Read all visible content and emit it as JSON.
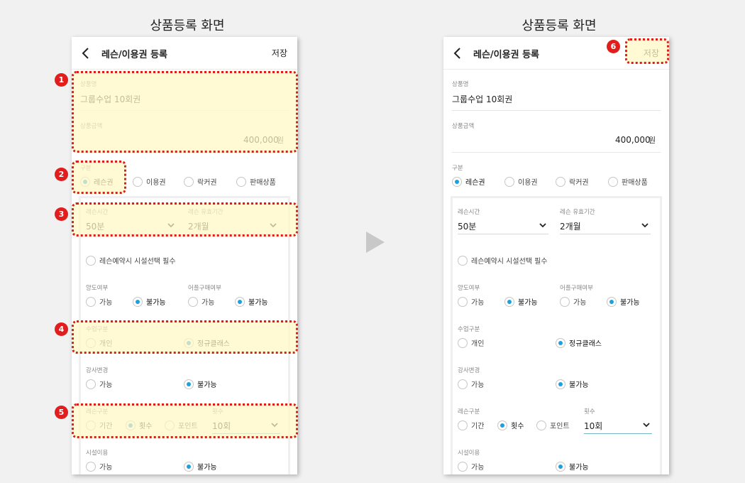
{
  "screen_title": "상품등록 화면",
  "app_bar": {
    "title": "레슨/이용권 등록",
    "save_label": "저장"
  },
  "form": {
    "product_name": {
      "label": "상품명",
      "value": "그룹수업 10회권"
    },
    "product_price": {
      "label": "상품금액",
      "value": "400,000",
      "unit": "원"
    },
    "category": {
      "label": "구분",
      "options": [
        "레슨권",
        "이용권",
        "락커권",
        "판매상품"
      ],
      "selected": "레슨권"
    },
    "lesson_time": {
      "label": "레슨시간",
      "value": "50분"
    },
    "lesson_period": {
      "label": "레슨 유효기간",
      "value": "2개월"
    },
    "facility_required": {
      "label": "레슨예약시 시설선택 필수"
    },
    "transfer": {
      "label": "양도여부",
      "options": [
        "가능",
        "불가능"
      ],
      "selected": "불가능"
    },
    "app_purchase": {
      "label": "어플구매여부",
      "options": [
        "가능",
        "불가능"
      ],
      "selected": "불가능"
    },
    "class_type": {
      "label": "수업구분",
      "options": [
        "개인",
        "정규클래스"
      ],
      "selected": "정규클래스"
    },
    "instructor_change": {
      "label": "강사변경",
      "options": [
        "가능",
        "불가능"
      ],
      "selected": "불가능"
    },
    "lesson_type": {
      "label": "레슨구분",
      "options": [
        "기간",
        "횟수",
        "포인트"
      ],
      "selected": "횟수"
    },
    "count": {
      "label": "횟수",
      "value": "10회"
    },
    "facility_use": {
      "label": "시설이용",
      "options": [
        "가능",
        "불가능"
      ],
      "selected": "불가능"
    }
  },
  "annotations": [
    "1",
    "2",
    "3",
    "4",
    "5",
    "6"
  ],
  "colors": {
    "radio_selected": "#1d9fe0",
    "highlight_border": "#d61f1f",
    "highlight_fill": "#fff8c4",
    "badge": "#e11d1d"
  }
}
